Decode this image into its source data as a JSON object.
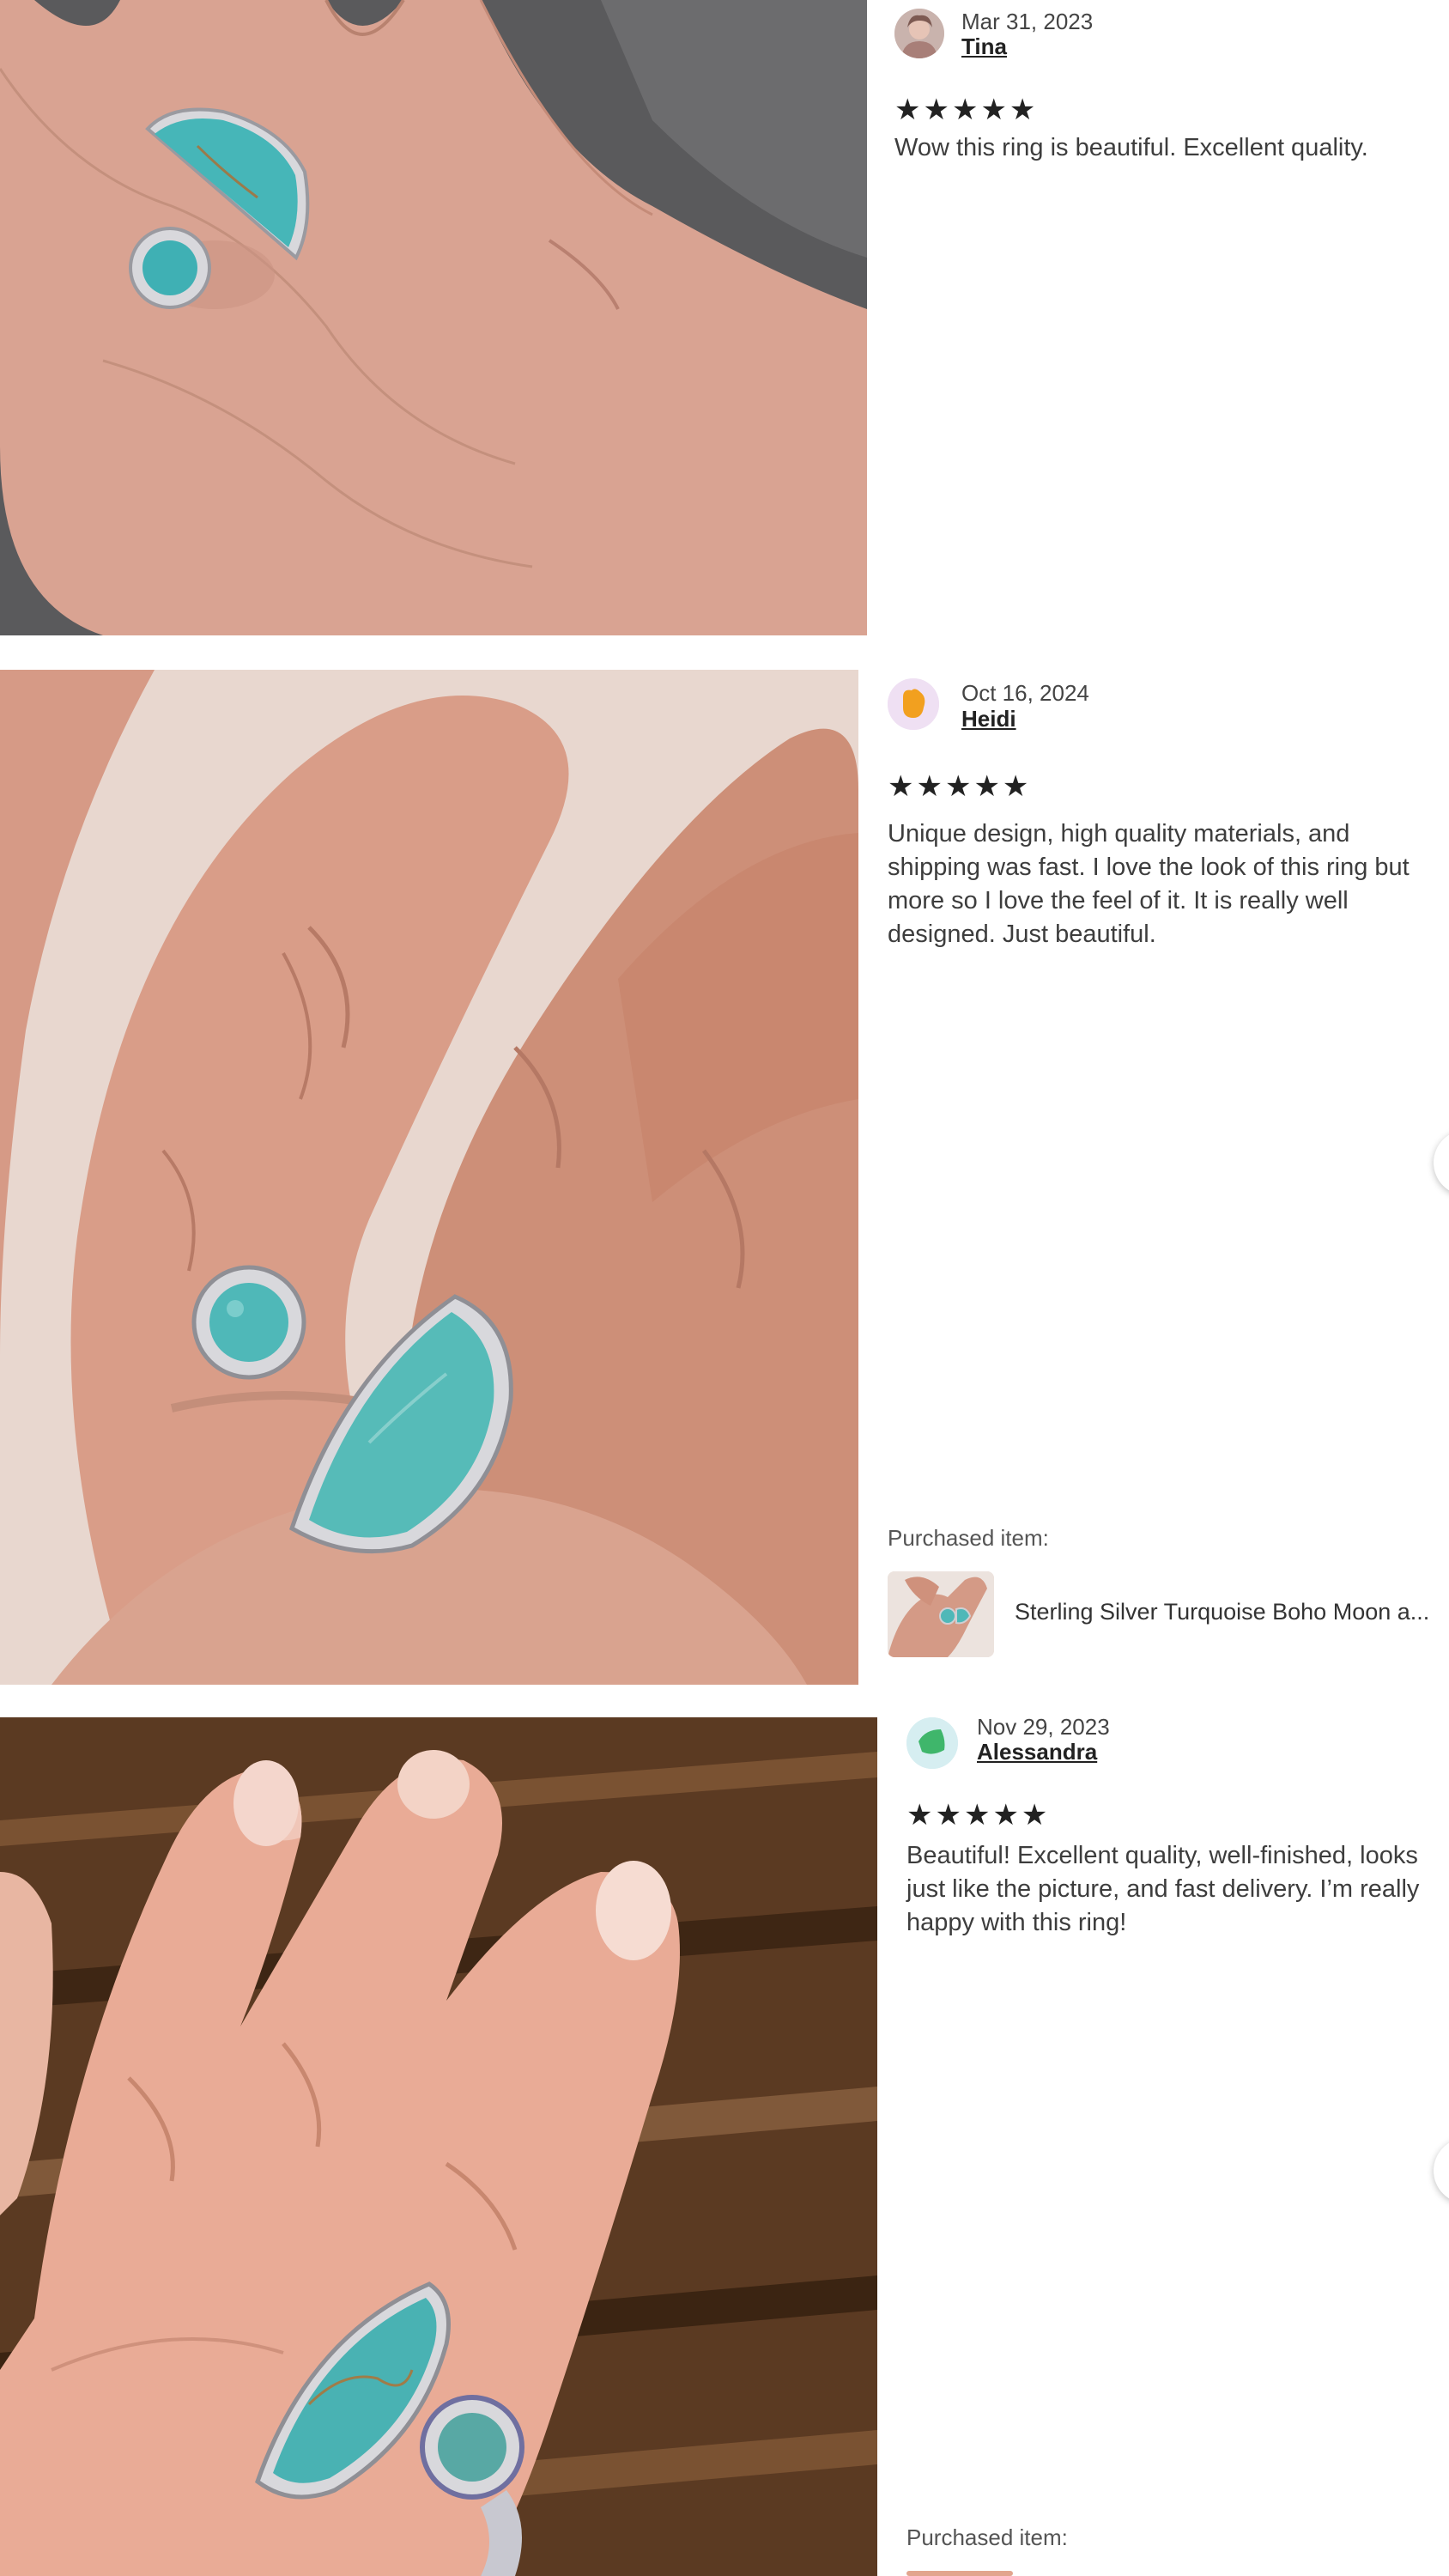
{
  "reviews": [
    {
      "date": "Mar 31, 2023",
      "reviewer": "Tina",
      "stars": "★★★★★",
      "text": "Wow this ring is beautiful. Excellent quality."
    },
    {
      "date": "Oct 16, 2024",
      "reviewer": "Heidi",
      "stars": "★★★★★",
      "text": "Unique design, high quality materials, and shipping was fast. I love the look of this ring but more so I love the feel of it. It is really well designed. Just beautiful.",
      "purchased_label": "Purchased item:",
      "purchased_title": "Sterling Silver Turquoise Boho Moon a..."
    },
    {
      "date": "Nov 29, 2023",
      "reviewer": "Alessandra",
      "stars": "★★★★★",
      "text": "Beautiful! Excellent quality, well-finished, looks just like the picture, and fast delivery. I’m really happy with this ring!",
      "purchased_label": "Purchased item:"
    }
  ],
  "colors": {
    "turquoise": "#4fb8b8",
    "skin": "#d9a08c",
    "silver": "#d8d8dc",
    "star": "#222222"
  }
}
